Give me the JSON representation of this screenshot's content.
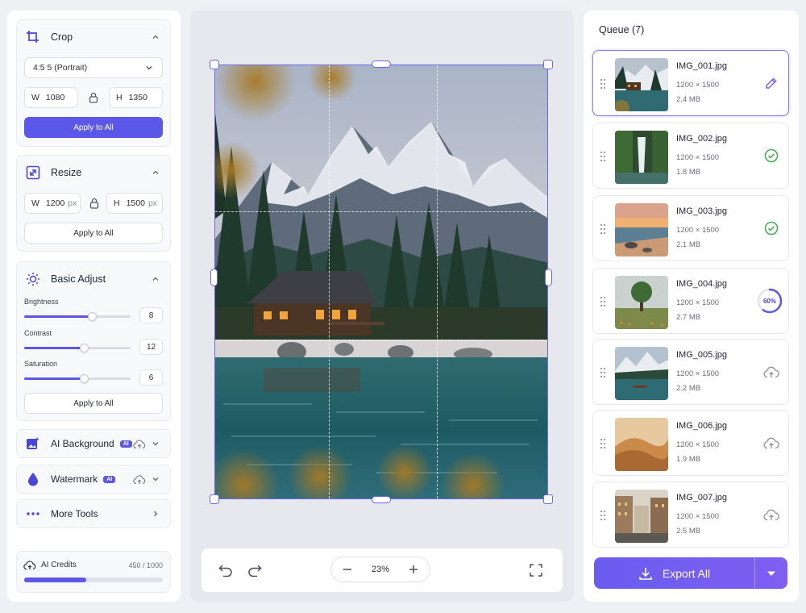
{
  "sidebar": {
    "crop": {
      "title": "Crop",
      "ratio": "4:5  5 (Portrait)",
      "w_key": "W",
      "w_value": "1080",
      "h_key": "H",
      "h_value": "1350",
      "apply_label": "Apply to All"
    },
    "resize": {
      "title": "Resize",
      "w_key": "W",
      "w_value": "1200",
      "w_unit": "px",
      "h_key": "H",
      "h_value": "1500",
      "h_unit": "px",
      "apply_label": "Apply to All"
    },
    "adjust": {
      "title": "Basic Adjust",
      "sliders": [
        {
          "label": "Brightness",
          "value": "8",
          "level": 0.64
        },
        {
          "label": "Contrast",
          "value": "12",
          "level": 0.56
        },
        {
          "label": "Saturation",
          "value": "6",
          "level": 0.56
        }
      ],
      "apply_label": "Apply to All"
    },
    "ai_background": {
      "title": "AI Background",
      "badge": "AI"
    },
    "watermark": {
      "title": "Watermark",
      "badge": "AI"
    },
    "more_tools": {
      "title": "More Tools"
    },
    "credits": {
      "label": "AI Credits",
      "count": "450 / 1000",
      "used_fraction": 0.45
    }
  },
  "canvas": {
    "zoom": "23%"
  },
  "queue": {
    "title": "Queue (7)",
    "items": [
      {
        "name": "IMG_001.jpg",
        "dims": "1200 × 1500",
        "size": "2.4 MB",
        "status": "editing",
        "status_icon": "pencil-icon"
      },
      {
        "name": "IMG_002.jpg",
        "dims": "1200 × 1500",
        "size": "1.8 MB",
        "status": "done",
        "status_icon": "check-circle-icon"
      },
      {
        "name": "IMG_003.jpg",
        "dims": "1200 × 1500",
        "size": "2.1 MB",
        "status": "done",
        "status_icon": "check-circle-icon"
      },
      {
        "name": "IMG_004.jpg",
        "dims": "1200 × 1500",
        "size": "2.7 MB",
        "status": "processing",
        "progress": "60%",
        "progress_fraction": 0.6
      },
      {
        "name": "IMG_005.jpg",
        "dims": "1200 × 1500",
        "size": "2.2 MB",
        "status": "pending",
        "status_icon": "cloud-upload-icon"
      },
      {
        "name": "IMG_006.jpg",
        "dims": "1200 × 1500",
        "size": "1.9 MB",
        "status": "pending",
        "status_icon": "cloud-upload-icon"
      },
      {
        "name": "IMG_007.jpg",
        "dims": "1200 × 1500",
        "size": "2.5 MB",
        "status": "pending",
        "status_icon": "cloud-upload-icon"
      }
    ],
    "export_label": "Export All"
  },
  "colors": {
    "accent": "#5b57e8",
    "done_green": "#3fae4f",
    "export_gradient_start": "#6a5cf0",
    "export_gradient_end": "#7e5ff2"
  }
}
